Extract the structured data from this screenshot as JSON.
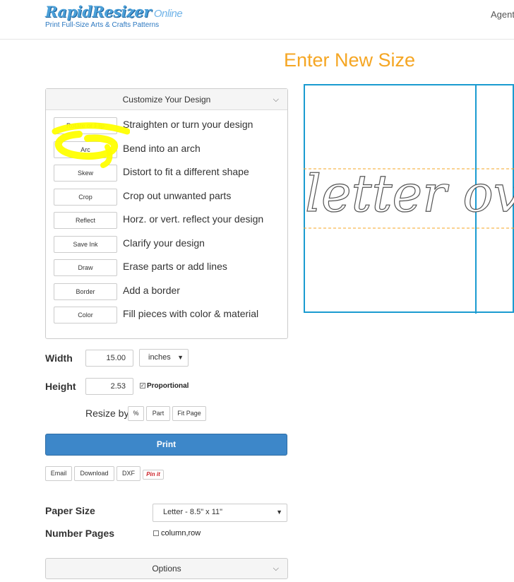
{
  "header": {
    "logo_main": "RapidResizer",
    "logo_sub": "Online",
    "tagline": "Print Full-Size Arts & Crafts Patterns",
    "nav_agent": "Agent"
  },
  "page_title": "Enter New Size",
  "customize": {
    "title": "Customize Your Design",
    "tools": [
      {
        "button": "Rotate or Flip",
        "desc": "Straighten or turn your design"
      },
      {
        "button": "Arc",
        "desc": "Bend into an arch"
      },
      {
        "button": "Skew",
        "desc": "Distort to fit a different shape"
      },
      {
        "button": "Crop",
        "desc": "Crop out unwanted parts"
      },
      {
        "button": "Reflect",
        "desc": "Horz. or vert. reflect your design"
      },
      {
        "button": "Save Ink",
        "desc": "Clarify your design"
      },
      {
        "button": "Draw",
        "desc": "Erase parts or add lines"
      },
      {
        "button": "Border",
        "desc": "Add a border"
      },
      {
        "button": "Color",
        "desc": "Fill pieces with color & material"
      }
    ]
  },
  "size": {
    "width_label": "Width",
    "width_value": "15.00",
    "unit": "inches",
    "height_label": "Height",
    "height_value": "2.53",
    "proportional_label": "Proportional",
    "proportional_checked": true,
    "resize_by_label": "Resize by",
    "resize_buttons": [
      "%",
      "Part",
      "Fit Page"
    ]
  },
  "print_label": "Print",
  "export_buttons": [
    "Email",
    "Download",
    "DXF"
  ],
  "pinit_label": "Pin it",
  "paper": {
    "paper_size_label": "Paper Size",
    "paper_size_value": "Letter - 8.5\" x 11\"",
    "number_pages_label": "Number Pages",
    "number_pages_option": "column,row",
    "number_pages_checked": false
  },
  "options_title": "Options",
  "preview": {
    "text": "letter ov"
  },
  "colors": {
    "accent_orange": "#f5a623",
    "print_blue": "#3d87c9",
    "page_border": "#1a9bd0",
    "guide_orange": "#f5a623",
    "highlight_yellow": "#ffff00"
  }
}
